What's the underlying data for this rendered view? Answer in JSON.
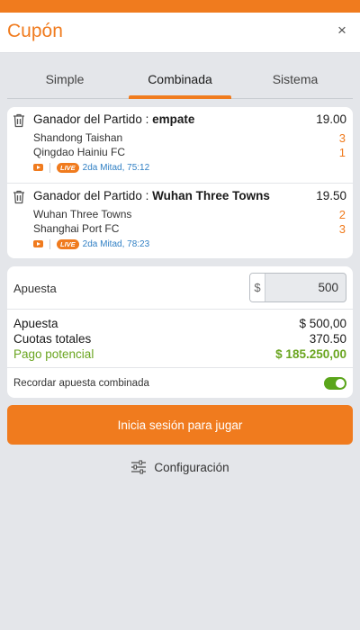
{
  "header": {
    "title": "Cupón",
    "close_glyph": "×"
  },
  "tabs": [
    {
      "label": "Simple",
      "active": false
    },
    {
      "label": "Combinada",
      "active": true
    },
    {
      "label": "Sistema",
      "active": false
    }
  ],
  "bets": [
    {
      "market_prefix": "Ganador del Partido : ",
      "selection": "empate",
      "odds": "19.00",
      "home_team": "Shandong Taishan",
      "home_score": "3",
      "away_team": "Qingdao Hainiu FC",
      "away_score": "1",
      "live_badge": "LIVE",
      "status": "2da Mitad, 75:12"
    },
    {
      "market_prefix": "Ganador del Partido : ",
      "selection": "Wuhan Three Towns",
      "odds": "19.50",
      "home_team": "Wuhan Three Towns",
      "home_score": "2",
      "away_team": "Shanghai Port FC",
      "away_score": "3",
      "live_badge": "LIVE",
      "status": "2da Mitad, 78:23"
    }
  ],
  "stake": {
    "label": "Apuesta",
    "currency": "$",
    "value": "500"
  },
  "summary": {
    "stake_label": "Apuesta",
    "stake_value": "$ 500,00",
    "odds_label": "Cuotas totales",
    "odds_value": "370.50",
    "payout_label": "Pago potencial",
    "payout_value": "$ 185.250,00"
  },
  "remember": {
    "label": "Recordar apuesta combinada",
    "enabled": true
  },
  "cta_label": "Inicia sesión para jugar",
  "config_label": "Configuración",
  "colors": {
    "accent": "#f07b1e",
    "link": "#2f7fc4",
    "success": "#6aa520"
  },
  "icons": [
    "trash-icon",
    "tv-icon",
    "close-icon",
    "settings-sliders-icon",
    "toggle-switch"
  ]
}
